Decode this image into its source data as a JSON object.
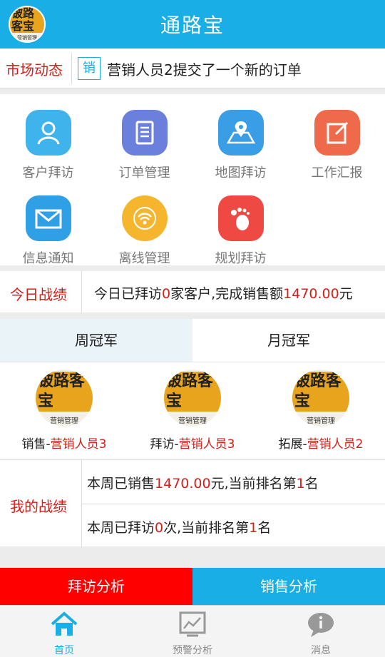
{
  "app": {
    "title": "通路宝",
    "logo_mark": "铍路客宝",
    "logo_sub": "营销管理"
  },
  "ticker": {
    "label": "市场动态",
    "tag": "销",
    "message": "营销人员2提交了一个新的订单"
  },
  "menu": [
    {
      "label": "客户拜访",
      "icon": "person-icon",
      "color": "#3fb4ec"
    },
    {
      "label": "订单管理",
      "icon": "document-list-icon",
      "color": "#6b7fdc"
    },
    {
      "label": "地图拜访",
      "icon": "map-pin-icon",
      "color": "#3a9ee6"
    },
    {
      "label": "工作汇报",
      "icon": "edit-icon",
      "color": "#ee6a4a"
    },
    {
      "label": "信息通知",
      "icon": "envelope-icon",
      "color": "#2f9fe6"
    },
    {
      "label": "离线管理",
      "icon": "wifi-icon",
      "color": "#f5b52c"
    },
    {
      "label": "规划拜访",
      "icon": "footprint-icon",
      "color": "#ef4944"
    }
  ],
  "today": {
    "label": "今日战绩",
    "pre": "今日已拜访",
    "visits": "0",
    "mid": "家客户,完成销售额",
    "amount": "1470.00",
    "unit": "元"
  },
  "tabs": {
    "week": "周冠军",
    "month": "月冠军"
  },
  "champions": [
    {
      "category": "销售-",
      "name": "营销人员3"
    },
    {
      "category": "拜访-",
      "name": "营销人员3"
    },
    {
      "category": "拓展-",
      "name": "营销人员2"
    }
  ],
  "my_record": {
    "label": "我的战绩",
    "row1": {
      "pre": "本周已销售",
      "amount": "1470.00",
      "mid": "元,当前排名第",
      "rank": "1",
      "post": "名"
    },
    "row2": {
      "pre": "本周已拜访",
      "count": "0",
      "mid": "次,当前排名第",
      "rank": "1",
      "post": "名"
    }
  },
  "buttons": {
    "visit_analysis": "拜访分析",
    "sales_analysis": "销售分析"
  },
  "nav": [
    {
      "label": "首页",
      "icon": "home-icon"
    },
    {
      "label": "预警分析",
      "icon": "chart-icon"
    },
    {
      "label": "消息",
      "icon": "message-icon"
    }
  ],
  "colors": {
    "header": "#1aaee6",
    "red": "#d4201a",
    "btn_left": "#ff0000",
    "btn_right": "#1aaee6"
  }
}
